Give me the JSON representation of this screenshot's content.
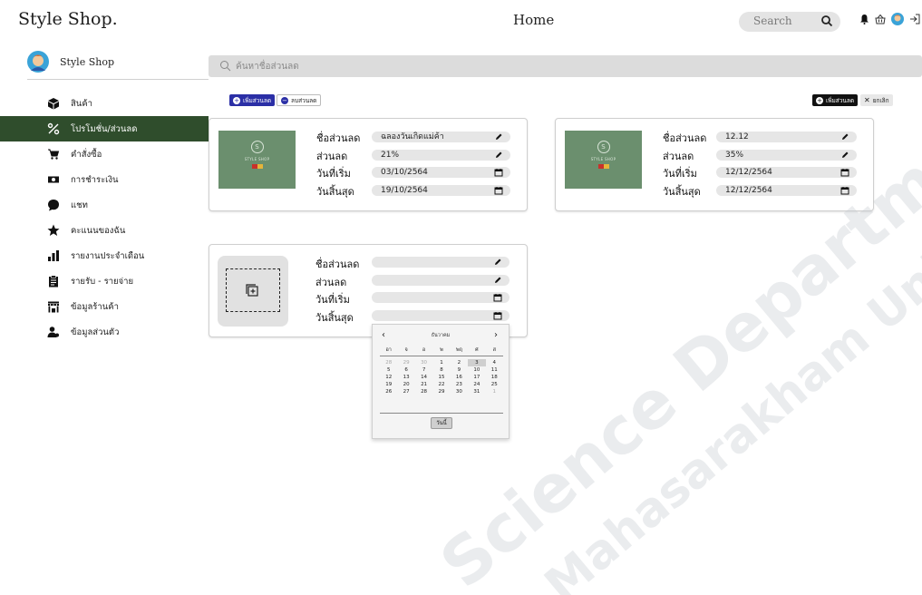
{
  "header": {
    "brand": "Style Shop.",
    "page_title": "Home",
    "search_placeholder": "Search"
  },
  "sidebar": {
    "profile_name": "Style Shop",
    "items": [
      {
        "label": "สินค้า",
        "icon": "box-icon"
      },
      {
        "label": "โปรโมชั่น/ส่วนลด",
        "icon": "percent-icon",
        "active": true
      },
      {
        "label": "คำสั่งซื้อ",
        "icon": "cart-icon"
      },
      {
        "label": "การชำระเงิน",
        "icon": "money-icon"
      },
      {
        "label": "แชท",
        "icon": "chat-icon"
      },
      {
        "label": "คะแนนของฉัน",
        "icon": "star-icon"
      },
      {
        "label": "รายงานประจำเดือน",
        "icon": "bar-chart-icon"
      },
      {
        "label": "รายรับ - รายจ่าย",
        "icon": "clipboard-icon"
      },
      {
        "label": "ข้อมูลร้านค้า",
        "icon": "store-icon"
      },
      {
        "label": "ข้อมูลส่วนตัว",
        "icon": "user-icon"
      }
    ]
  },
  "content": {
    "search_placeholder": "ค้นหาชื่อส่วนลด",
    "add_label": "เพิ่มส่วนลด",
    "delete_label": "ลบส่วนลด",
    "add_label_2": "เพิ่มส่วนลด",
    "cancel_label": "ยกเลิก"
  },
  "labels": {
    "name": "ชื่อส่วนลด",
    "discount": "ส่วนลด",
    "start": "วันที่เริ่ม",
    "end": "วันสิ้นสุด"
  },
  "thumb_text": {
    "logo_letter": "S",
    "store_text": "STYLE SHOP"
  },
  "cards": [
    {
      "name": "ฉลองวันเกิดแม่ค้า",
      "discount": "21%",
      "start": "03/10/2564",
      "end": "19/10/2564"
    },
    {
      "name": "12.12",
      "discount": "35%",
      "start": "12/12/2564",
      "end": "12/12/2564"
    },
    {
      "name": "",
      "discount": "",
      "start": "",
      "end": ""
    }
  ],
  "calendar": {
    "month": "ธันวาคม",
    "weekdays": [
      "อา",
      "จ",
      "อ",
      "พ",
      "พฤ",
      "ศ",
      "ส"
    ],
    "days": [
      [
        "28",
        "29",
        "30",
        "1",
        "2",
        "3",
        "4"
      ],
      [
        "5",
        "6",
        "7",
        "8",
        "9",
        "10",
        "11"
      ],
      [
        "12",
        "13",
        "14",
        "15",
        "16",
        "17",
        "18"
      ],
      [
        "19",
        "20",
        "21",
        "22",
        "23",
        "24",
        "25"
      ],
      [
        "26",
        "27",
        "28",
        "29",
        "30",
        "31",
        "1"
      ]
    ],
    "selected_day": "3",
    "today_label": "วันนี้"
  },
  "watermark": {
    "line1": "Science Department",
    "line2": "Mahasarakham University"
  }
}
